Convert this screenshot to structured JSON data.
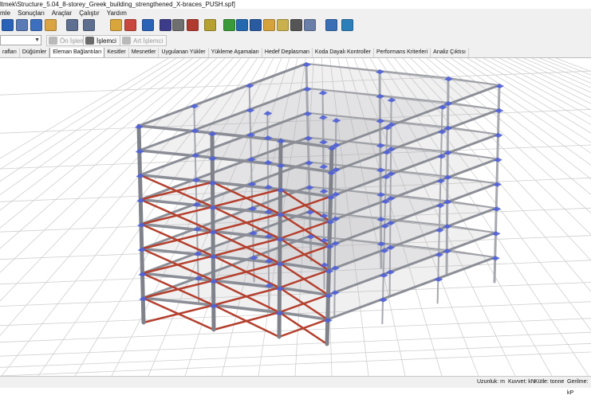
{
  "window": {
    "title": "ltmek\\Structure_5.04_8-storey_Greek_building_strengthened_X-braces_PUSH.spf]"
  },
  "menu": {
    "items": [
      "mle",
      "Sonuçları",
      "Araçlar",
      "Çalıştır",
      "Yardım"
    ]
  },
  "toolbar": {
    "icons": [
      {
        "name": "save-icon",
        "color": "#2a62b8"
      },
      {
        "name": "print-icon",
        "color": "#5a7bb5"
      },
      {
        "name": "preview-icon",
        "color": "#3d6fbf"
      },
      {
        "name": "clipboard-icon",
        "color": "#d9a441"
      },
      {
        "name": "undo-icon",
        "color": "#5e6f8f"
      },
      {
        "name": "redo-icon",
        "color": "#5e6f8f"
      },
      {
        "name": "grid-icon",
        "color": "#d8a63a"
      },
      {
        "name": "frame-icon",
        "color": "#c9473c"
      },
      {
        "name": "connect-icon",
        "color": "#2a62b8"
      },
      {
        "name": "unit-icon",
        "color": "#3c3c8a"
      },
      {
        "name": "settings-icon",
        "color": "#6f6f6f"
      },
      {
        "name": "check-icon",
        "color": "#b13a2e"
      },
      {
        "name": "brush-icon",
        "color": "#b5a030"
      },
      {
        "name": "help-icon",
        "color": "#3a9a3a"
      },
      {
        "name": "book-icon",
        "color": "#2468b0"
      },
      {
        "name": "library-icon",
        "color": "#2a5aa0"
      },
      {
        "name": "folder-icon",
        "color": "#d6a23c"
      },
      {
        "name": "note-icon",
        "color": "#c9b04c"
      },
      {
        "name": "film-icon",
        "color": "#555555"
      },
      {
        "name": "tools-icon",
        "color": "#6a7fa8"
      },
      {
        "name": "edit-icon",
        "color": "#3a6fb5"
      },
      {
        "name": "globe-icon",
        "color": "#2c7fb8"
      }
    ]
  },
  "toolbar2": {
    "previous_label": "Ön İşlemci",
    "processor_label": "İşlemci",
    "post_label": "Art İşlemci"
  },
  "tabs": [
    {
      "label": "rafları",
      "active": false
    },
    {
      "label": "Düğümler",
      "active": false
    },
    {
      "label": "Eleman Bağlantıları",
      "active": true
    },
    {
      "label": "Kesitler",
      "active": false
    },
    {
      "label": "Mesnetler",
      "active": false
    },
    {
      "label": "Uygulanan Yükler",
      "active": false
    },
    {
      "label": "Yükleme Aşamaları",
      "active": false
    },
    {
      "label": "Hedef Deplasman",
      "active": false
    },
    {
      "label": "Koda Dayalı Kontroller",
      "active": false
    },
    {
      "label": "Performans Kriterleri",
      "active": false
    },
    {
      "label": "Analiz Çıktısı",
      "active": false
    }
  ],
  "status": {
    "length": "Uzunluk: m",
    "force": "Kuvvet: kN",
    "mass": "Kütle: tonne",
    "stress": "Gerilme: kP"
  },
  "colors": {
    "frame": "#8b8e96",
    "brace": "#b4402e",
    "support": "#4f5fd6",
    "grid": "#cfcfcf"
  }
}
